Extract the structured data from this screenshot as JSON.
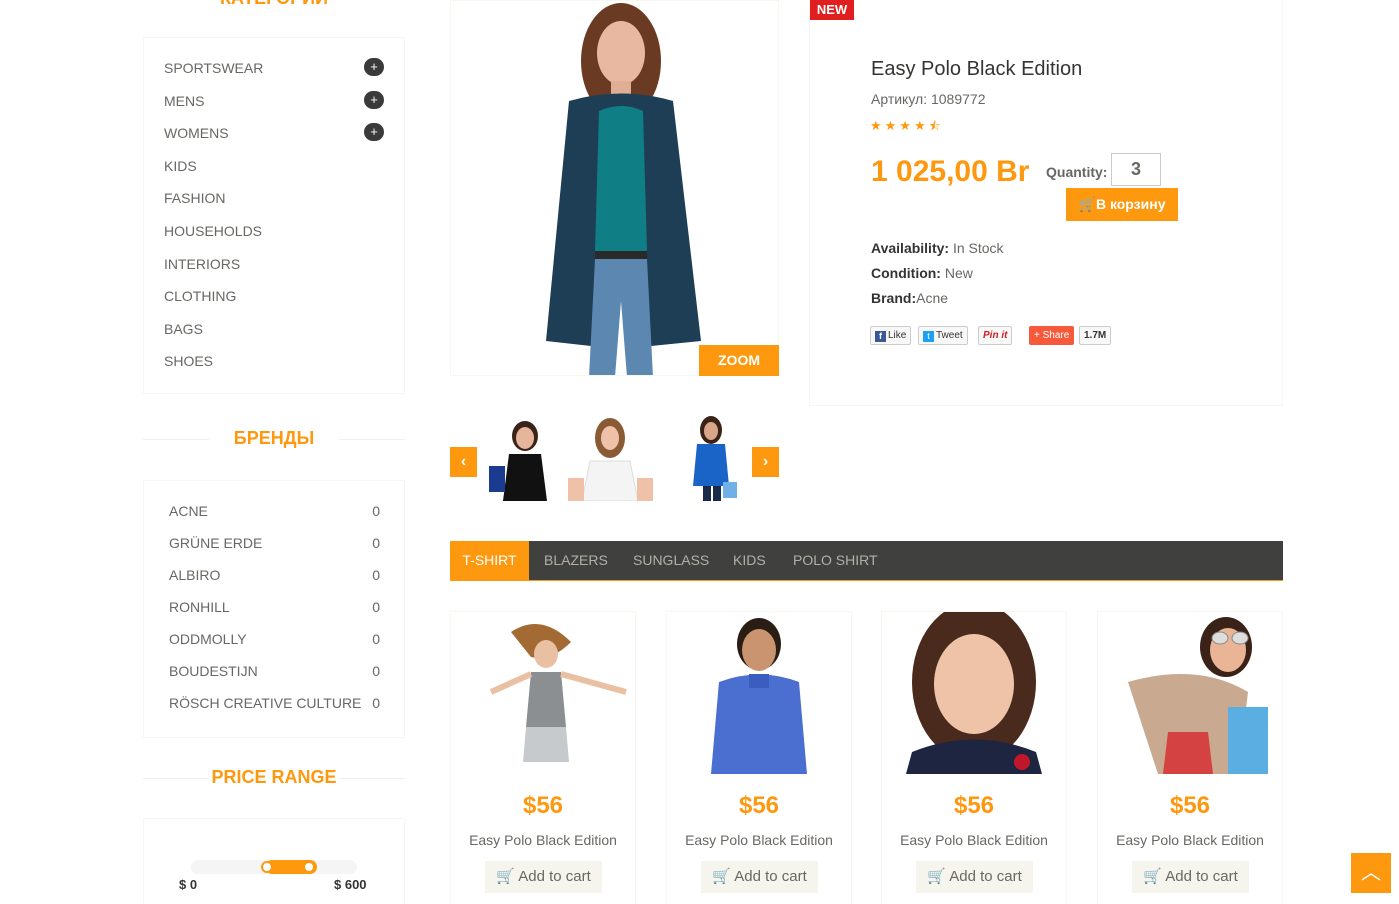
{
  "sidebar": {
    "categories_title": "КАТЕГОРИИ",
    "categories": [
      {
        "label": "SPORTSWEAR",
        "expandable": true
      },
      {
        "label": "MENS",
        "expandable": true
      },
      {
        "label": "WOMENS",
        "expandable": true
      },
      {
        "label": "KIDS",
        "expandable": false
      },
      {
        "label": "FASHION",
        "expandable": false
      },
      {
        "label": "HOUSEHOLDS",
        "expandable": false
      },
      {
        "label": "INTERIORS",
        "expandable": false
      },
      {
        "label": "CLOTHING",
        "expandable": false
      },
      {
        "label": "BAGS",
        "expandable": false
      },
      {
        "label": "SHOES",
        "expandable": false
      }
    ],
    "plus_symbol": "+",
    "brands_title": "БРЕНДЫ",
    "brands": [
      {
        "name": "ACNE",
        "count": "0"
      },
      {
        "name": "GRÜNE ERDE",
        "count": "0"
      },
      {
        "name": "ALBIRO",
        "count": "0"
      },
      {
        "name": "RONHILL",
        "count": "0"
      },
      {
        "name": "ODDMOLLY",
        "count": "0"
      },
      {
        "name": "BOUDESTIJN",
        "count": "0"
      },
      {
        "name": "RÖSCH CREATIVE CULTURE",
        "count": "0"
      }
    ],
    "price_range_title": "PRICE RANGE",
    "price_min_label": "$ 0",
    "price_max_label": "$ 600"
  },
  "product": {
    "badge": "NEW",
    "zoom_label": "ZOOM",
    "title": "Easy Polo Black Edition",
    "sku": "Артикул: 1089772",
    "rating": 4.5,
    "stars": "★★★★⯪",
    "price": "1 025,00 Br",
    "quantity_label": "Quantity:",
    "quantity_value": "3",
    "add_to_cart_label": "В корзину",
    "availability_label": "Availability:",
    "availability_value": " In Stock",
    "condition_label": "Condition:",
    "condition_value": " New",
    "brand_label": "Brand:",
    "brand_value": "Acne",
    "share": {
      "like": "Like",
      "tweet": "Tweet",
      "pinit": "Pin it",
      "share": "Share",
      "share_count": "1.7M"
    }
  },
  "tabs": [
    {
      "label": "T-SHIRT",
      "active": true
    },
    {
      "label": "BLAZERS",
      "active": false
    },
    {
      "label": "SUNGLASS",
      "active": false
    },
    {
      "label": "KIDS",
      "active": false
    },
    {
      "label": "POLO SHIRT",
      "active": false
    }
  ],
  "products": [
    {
      "price": "$56",
      "name": "Easy Polo Black Edition",
      "button": "Add to cart"
    },
    {
      "price": "$56",
      "name": "Easy Polo Black Edition",
      "button": "Add to cart"
    },
    {
      "price": "$56",
      "name": "Easy Polo Black Edition",
      "button": "Add to cart"
    },
    {
      "price": "$56",
      "name": "Easy Polo Black Edition",
      "button": "Add to cart"
    }
  ],
  "colors": {
    "accent": "#FE980F",
    "badge_red": "#E02020",
    "tab_bar": "#40403E"
  }
}
